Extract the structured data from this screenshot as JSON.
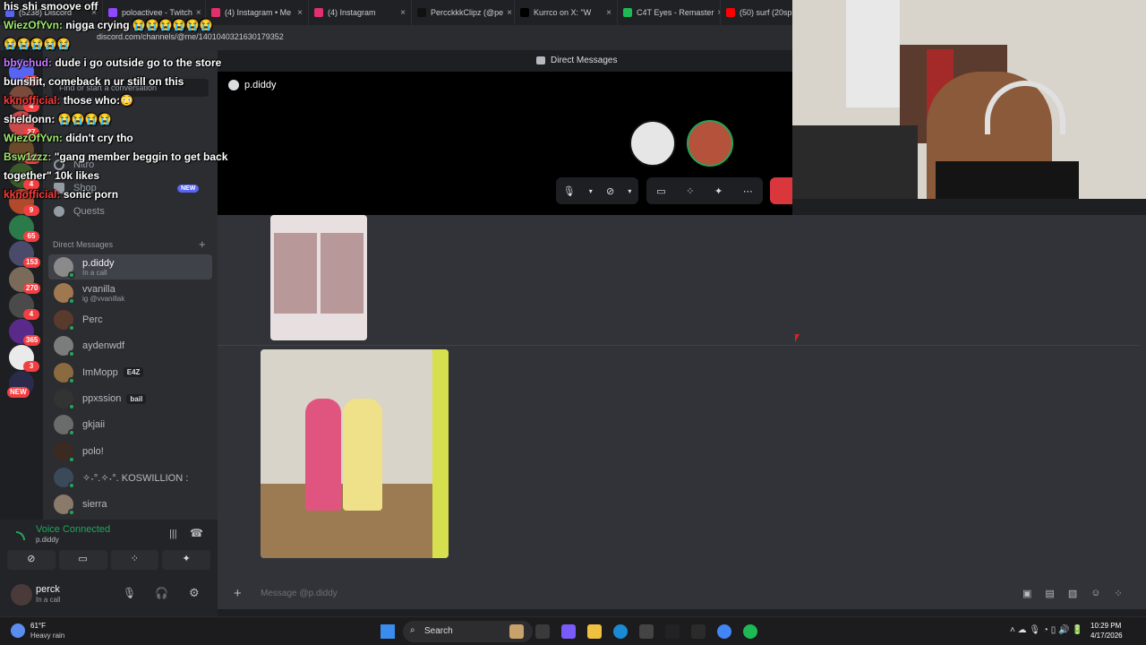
{
  "browser": {
    "tabs": [
      {
        "label": "(5238) Discord",
        "color": "#5865f2"
      },
      {
        "label": "poloactivee - Twitch",
        "color": "#9146ff"
      },
      {
        "label": "(4) Instagram • Me",
        "color": "#e1306c"
      },
      {
        "label": "(4) Instagram",
        "color": "#e1306c"
      },
      {
        "label": "PercckkkClipz (@pe",
        "color": "#111111"
      },
      {
        "label": "Kurrco on X: \"W",
        "color": "#000000"
      },
      {
        "label": "C4T Eyes - Remaster",
        "color": "#1db954"
      },
      {
        "label": "(50) surf (20sp",
        "color": "#ff0000"
      }
    ],
    "url": "discord.com/channels/@me/1401040321630179352"
  },
  "overlay_chat": [
    {
      "user": "",
      "text": "his shi smoove off",
      "color": "#ffffff"
    },
    {
      "user": "WiezOfYvn:",
      "text": "nigga crying 😭😭😭😭😭😭",
      "color": "#9fe870"
    },
    {
      "user": "",
      "text": "😭😭😭😭😭",
      "color": "#ffffff"
    },
    {
      "user": "bbychud:",
      "text": "dude i go outside go to the store",
      "color": "#c77dff"
    },
    {
      "user": "",
      "text": "bunshit, comeback n ur still on this",
      "color": "#ffffff"
    },
    {
      "user": "kknofficial:",
      "text": "those who:😳",
      "color": "#ff3b3b"
    },
    {
      "user": "sheldonn:",
      "text": "😭😭😭😭",
      "color": "#ffffff"
    },
    {
      "user": "WiezOfYvn:",
      "text": "didn't cry tho",
      "color": "#9fe870"
    },
    {
      "user": "Bsw1zzz:",
      "text": "\"gang member beggin to get back",
      "color": "#9fe870"
    },
    {
      "user": "",
      "text": "together\" 10k likes",
      "color": "#ffffff"
    },
    {
      "user": "kknofficial:",
      "text": "sonic porn",
      "color": "#ff3b3b"
    }
  ],
  "call": {
    "header_title": "Direct Messages",
    "channel_name": "p.diddy"
  },
  "sidebar": {
    "search_placeholder": "Find or start a conversation",
    "nav": [
      {
        "label": "Nitro"
      },
      {
        "label": "Shop",
        "badge": "NEW"
      },
      {
        "label": "Quests"
      }
    ],
    "dm_header": "Direct Messages",
    "dms": [
      {
        "name": "p.diddy",
        "sub": "In a call",
        "color": "#8a8a8a"
      },
      {
        "name": "vvanilla",
        "sub": "ig @vvanillak",
        "color": "#a07850"
      },
      {
        "name": "Perc",
        "sub": "",
        "color": "#5b3a2e"
      },
      {
        "name": "aydenwdf",
        "sub": "",
        "color": "#7c7c7c"
      },
      {
        "name": "ImMopp",
        "sub": "",
        "tag": "E4Z",
        "color": "#8c6a3f"
      },
      {
        "name": "ppxssion",
        "sub": "",
        "tag": "bail",
        "color": "#333333"
      },
      {
        "name": "gkjaii",
        "sub": "",
        "color": "#6b6b6b"
      },
      {
        "name": "polo!",
        "sub": "",
        "color": "#3a2a22"
      },
      {
        "name": "✧˖°.✧˖°. KOSWILLION :",
        "sub": "",
        "color": "#3a4a5a"
      },
      {
        "name": "sierra",
        "sub": "",
        "color": "#8a7a6a"
      }
    ]
  },
  "server_badges": [
    "20",
    "4",
    "27",
    "247",
    "4",
    "9",
    "65",
    "153",
    "270",
    "4",
    "365",
    "3",
    "NEW"
  ],
  "voice": {
    "status": "Voice Connected",
    "channel": "p.diddy"
  },
  "user": {
    "name": "perck",
    "status": "In a call"
  },
  "chat": {
    "input_placeholder": "Message @p.diddy"
  },
  "taskbar": {
    "weather_temp": "61°F",
    "weather_desc": "Heavy rain",
    "search_label": "Search",
    "time": "10:29 PM",
    "date": "4/17/2026"
  },
  "colors": {
    "accent": "#5865f2",
    "green": "#23a55a",
    "red": "#da373c"
  }
}
